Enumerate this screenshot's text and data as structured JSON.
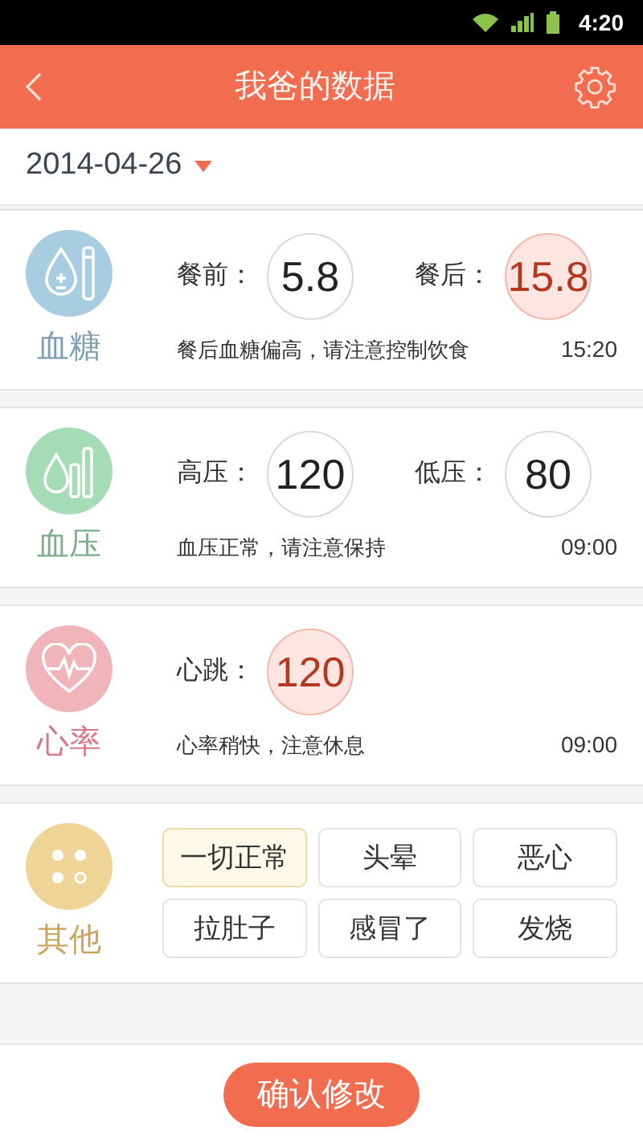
{
  "status_bar": {
    "time": "4:20"
  },
  "header": {
    "title": "我爸的数据"
  },
  "date_picker": {
    "value": "2014-04-26"
  },
  "cards": [
    {
      "kind": "glucose",
      "label": "血糖",
      "color": "#a9cde0",
      "readings": [
        {
          "label": "餐前：",
          "value": "5.8",
          "high": false
        },
        {
          "label": "餐后：",
          "value": "15.8",
          "high": true
        }
      ],
      "note": "餐后血糖偏高，请注意控制饮食",
      "time": "15:20"
    },
    {
      "kind": "pressure",
      "label": "血压",
      "color": "#a6dcb5",
      "readings": [
        {
          "label": "高压：",
          "value": "120",
          "high": false
        },
        {
          "label": "低压：",
          "value": "80",
          "high": false
        }
      ],
      "note": "血压正常，请注意保持",
      "time": "09:00"
    },
    {
      "kind": "heart",
      "label": "心率",
      "color": "#f0b4bb",
      "readings": [
        {
          "label": "心跳：",
          "value": "120",
          "high": true
        }
      ],
      "note": "心率稍快，注意休息",
      "time": "09:00"
    },
    {
      "kind": "other",
      "label": "其他",
      "color": "#eed597",
      "symptoms": [
        {
          "label": "一切正常",
          "selected": true
        },
        {
          "label": "头晕",
          "selected": false
        },
        {
          "label": "恶心",
          "selected": false
        },
        {
          "label": "拉肚子",
          "selected": false
        },
        {
          "label": "感冒了",
          "selected": false
        },
        {
          "label": "发烧",
          "selected": false
        }
      ]
    }
  ],
  "confirm_button": "确认修改"
}
